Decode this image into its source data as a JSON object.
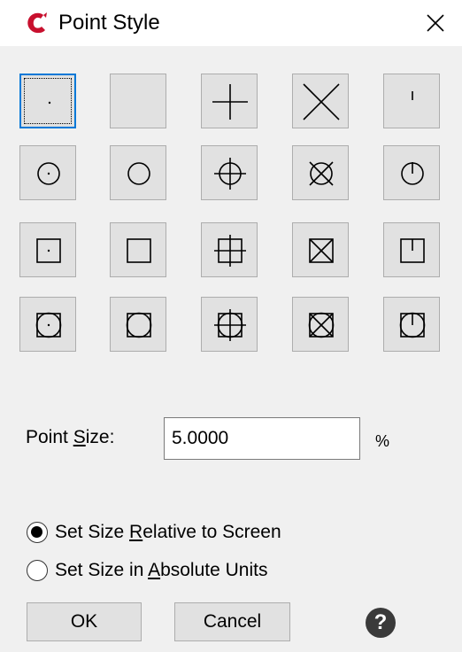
{
  "window": {
    "title": "Point Style",
    "app_icon": "autocad-logo-icon",
    "close_icon": "close-icon"
  },
  "point_styles": {
    "rows": 4,
    "cols": 5,
    "selected_index": 0,
    "styles": [
      "dot",
      "none",
      "plus",
      "cross",
      "tick",
      "circle-dot",
      "circle",
      "circle-plus",
      "circle-cross",
      "circle-tick",
      "square-dot",
      "square",
      "square-plus",
      "square-cross",
      "square-tick",
      "circle-square-dot",
      "circle-square",
      "circle-square-plus",
      "circle-square-cross",
      "circle-square-tick"
    ]
  },
  "point_size": {
    "label_before": "Point ",
    "label_mnemonic": "S",
    "label_after": "ize:",
    "value": "5.0000",
    "unit": "%"
  },
  "size_mode": {
    "options": [
      {
        "before": "Set Size ",
        "mnemonic": "R",
        "after": "elative to Screen",
        "checked": true
      },
      {
        "before": "Set Size in ",
        "mnemonic": "A",
        "after": "bsolute Units",
        "checked": false
      }
    ]
  },
  "buttons": {
    "ok": "OK",
    "cancel": "Cancel",
    "help": "?"
  },
  "colors": {
    "title_bar": "#ffffff",
    "dialog_bg": "#f0f0f0",
    "button_face": "#e1e1e1",
    "selection_border": "#0078d7",
    "app_icon_red": "#c8102e"
  }
}
